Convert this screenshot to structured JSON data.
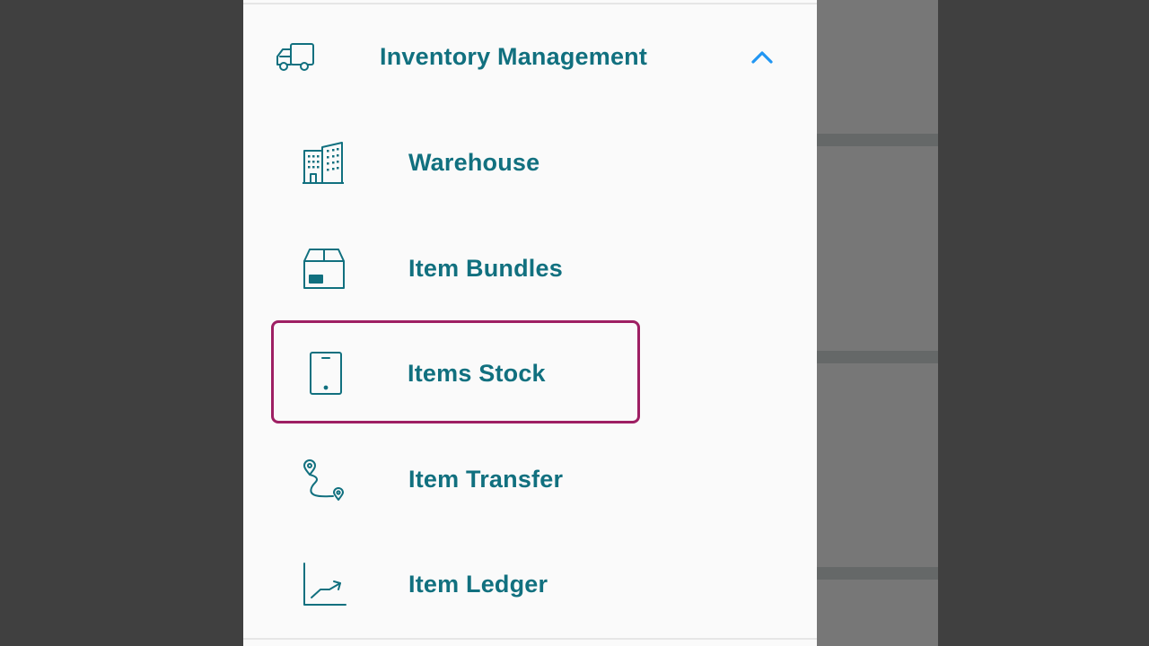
{
  "colors": {
    "accent": "#11707f",
    "chevron": "#2196f3",
    "selection_border": "#9e1f63",
    "drawer_background": "#fafafa",
    "backdrop": "#777777"
  },
  "menu": {
    "group": {
      "title": "Inventory Management",
      "icon": "truck-icon",
      "expanded": true
    },
    "items": [
      {
        "label": "Warehouse",
        "icon": "buildings-icon",
        "selected": false
      },
      {
        "label": "Item Bundles",
        "icon": "box-icon",
        "selected": false
      },
      {
        "label": "Items Stock",
        "icon": "tablet-icon",
        "selected": true
      },
      {
        "label": "Item Transfer",
        "icon": "route-icon",
        "selected": false
      },
      {
        "label": "Item Ledger",
        "icon": "trend-chart-icon",
        "selected": false
      }
    ]
  }
}
